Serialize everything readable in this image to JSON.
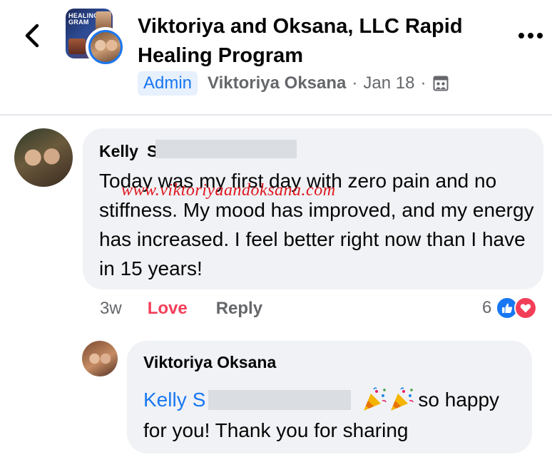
{
  "post": {
    "title": "Viktoriya and Oksana, LLC Rapid Healing Program",
    "cover_text": "HEALING GRAM",
    "badge": "Admin",
    "author": "Viktoriya Oksana",
    "separator": "·",
    "date": "Jan 18"
  },
  "comment": {
    "author_first": "Kelly",
    "author_trail": "S",
    "text": "Today was my first day with zero pain and no stiffness. My mood has improved, and my energy has increased. I feel better right now than I have in 15 years!",
    "time": "3w",
    "love_label": "Love",
    "reply_label": "Reply",
    "reaction_count": "6"
  },
  "watermark": "www.viktoriyaandoksana.com",
  "reply": {
    "author": "Viktoriya Oksana",
    "mention_first": "Kelly",
    "mention_trail": "S",
    "text_line1": "so happy",
    "text_line2": "for you! Thank you for sharing"
  },
  "colors": {
    "accent": "#1877f2",
    "love": "#f33e58",
    "watermark": "#e0161e",
    "bubble": "#f0f2f5",
    "muted": "#65676b"
  },
  "icons": {
    "back": "chevron-left-icon",
    "more": "ellipsis-icon",
    "privacy": "group-privacy-icon",
    "like": "thumbs-up-icon",
    "love": "heart-icon",
    "party": "party-popper-icon"
  }
}
